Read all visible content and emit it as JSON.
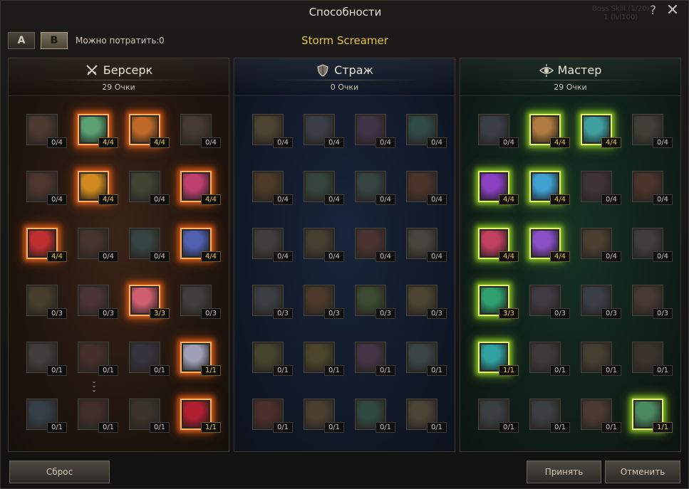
{
  "window": {
    "title": "Способности",
    "help_label": "?",
    "close_label": "✕",
    "ghost_lines": [
      "Boss Skill (1/20)",
      "1 (lvl100)"
    ]
  },
  "toolbar": {
    "preset_a": "A",
    "preset_b": "B",
    "spend_label": "Можно потратить:",
    "spend_value": "0",
    "character": "Storm Screamer"
  },
  "colors": {
    "accent": "#f0c040",
    "active_red_glow": "#c85418",
    "active_green_glow": "#7ab420"
  },
  "trees": [
    {
      "name": "Берсерк",
      "icon": "crossed-swords-icon",
      "points": "29 Очки",
      "glow": "red",
      "skills": [
        {
          "rank": "0/4",
          "active": false,
          "c": "#8a5a48"
        },
        {
          "rank": "4/4",
          "active": true,
          "c": "#5aa070"
        },
        {
          "rank": "4/4",
          "active": true,
          "c": "#c06a28"
        },
        {
          "rank": "0/4",
          "active": false,
          "c": "#7a5a4a"
        },
        {
          "rank": "0/4",
          "active": false,
          "c": "#8a5040"
        },
        {
          "rank": "4/4",
          "active": true,
          "c": "#d08a20"
        },
        {
          "rank": "0/4",
          "active": false,
          "c": "#6a7a50"
        },
        {
          "rank": "4/4",
          "active": true,
          "c": "#c04070"
        },
        {
          "rank": "4/4",
          "active": true,
          "c": "#c03030"
        },
        {
          "rank": "0/4",
          "active": false,
          "c": "#7a4a3a"
        },
        {
          "rank": "0/4",
          "active": false,
          "c": "#4a7a7a"
        },
        {
          "rank": "4/4",
          "active": true,
          "c": "#5060b0"
        },
        {
          "rank": "0/3",
          "active": false,
          "c": "#7a6a3a"
        },
        {
          "rank": "0/3",
          "active": false,
          "c": "#8a4a5a"
        },
        {
          "rank": "3/3",
          "active": true,
          "c": "#d06070"
        },
        {
          "rank": "0/3",
          "active": false,
          "c": "#6a6a6a"
        },
        {
          "rank": "0/1",
          "active": false,
          "c": "#6a6a6a"
        },
        {
          "rank": "0/1",
          "active": false,
          "c": "#7a3a3a"
        },
        {
          "rank": "0/1",
          "active": false,
          "c": "#4a4a6a"
        },
        {
          "rank": "1/1",
          "active": true,
          "c": "#a0a0b8"
        },
        {
          "rank": "0/1",
          "active": false,
          "c": "#4a6a8a"
        },
        {
          "rank": "0/1",
          "active": false,
          "c": "#6a3a3a"
        },
        {
          "rank": "0/1",
          "active": false,
          "c": "#5a4a3a"
        },
        {
          "rank": "1/1",
          "active": true,
          "c": "#b02030"
        }
      ]
    },
    {
      "name": "Страж",
      "icon": "shield-icon",
      "points": "0 Очки",
      "glow": "none",
      "skills": [
        {
          "rank": "0/4",
          "active": false,
          "c": "#8a7a4a"
        },
        {
          "rank": "0/4",
          "active": false,
          "c": "#5a6a8a"
        },
        {
          "rank": "0/4",
          "active": false,
          "c": "#6a4a8a"
        },
        {
          "rank": "0/4",
          "active": false,
          "c": "#3a8a8a"
        },
        {
          "rank": "0/4",
          "active": false,
          "c": "#8a5a2a"
        },
        {
          "rank": "0/4",
          "active": false,
          "c": "#4a7a6a"
        },
        {
          "rank": "0/4",
          "active": false,
          "c": "#4a7a7a"
        },
        {
          "rank": "0/4",
          "active": false,
          "c": "#8a4a3a"
        },
        {
          "rank": "0/4",
          "active": false,
          "c": "#6a6a6a"
        },
        {
          "rank": "0/4",
          "active": false,
          "c": "#7a6a4a"
        },
        {
          "rank": "0/4",
          "active": false,
          "c": "#8a4a4a"
        },
        {
          "rank": "0/4",
          "active": false,
          "c": "#7a7a6a"
        },
        {
          "rank": "0/3",
          "active": false,
          "c": "#5a6a7a"
        },
        {
          "rank": "0/3",
          "active": false,
          "c": "#8a5a3a"
        },
        {
          "rank": "0/3",
          "active": false,
          "c": "#5a8a4a"
        },
        {
          "rank": "0/3",
          "active": false,
          "c": "#8a7a4a"
        },
        {
          "rank": "0/1",
          "active": false,
          "c": "#7a7a3a"
        },
        {
          "rank": "0/1",
          "active": false,
          "c": "#8a7a3a"
        },
        {
          "rank": "0/1",
          "active": false,
          "c": "#7a4a8a"
        },
        {
          "rank": "0/1",
          "active": false,
          "c": "#5a7a8a"
        },
        {
          "rank": "0/1",
          "active": false,
          "c": "#8a3a3a"
        },
        {
          "rank": "0/1",
          "active": false,
          "c": "#8a6a4a"
        },
        {
          "rank": "0/1",
          "active": false,
          "c": "#3a8a7a"
        },
        {
          "rank": "0/1",
          "active": false,
          "c": "#8a7a5a"
        }
      ]
    },
    {
      "name": "Мастер",
      "icon": "eye-icon",
      "points": "29 Очки",
      "glow": "green",
      "skills": [
        {
          "rank": "0/4",
          "active": false,
          "c": "#5a6a8a"
        },
        {
          "rank": "4/4",
          "active": true,
          "c": "#b07a40"
        },
        {
          "rank": "4/4",
          "active": true,
          "c": "#40a0a0"
        },
        {
          "rank": "0/4",
          "active": false,
          "c": "#6a6a5a"
        },
        {
          "rank": "4/4",
          "active": true,
          "c": "#8a40c0"
        },
        {
          "rank": "4/4",
          "active": true,
          "c": "#40a0d0"
        },
        {
          "rank": "0/4",
          "active": false,
          "c": "#6a4a5a"
        },
        {
          "rank": "0/4",
          "active": false,
          "c": "#8a4a3a"
        },
        {
          "rank": "4/4",
          "active": true,
          "c": "#c04060"
        },
        {
          "rank": "4/4",
          "active": true,
          "c": "#8a50c8"
        },
        {
          "rank": "0/4",
          "active": false,
          "c": "#8a6a4a"
        },
        {
          "rank": "0/4",
          "active": false,
          "c": "#6a6a6a"
        },
        {
          "rank": "3/3",
          "active": true,
          "c": "#30a070"
        },
        {
          "rank": "0/3",
          "active": false,
          "c": "#6a5a7a"
        },
        {
          "rank": "0/3",
          "active": false,
          "c": "#5a6a8a"
        },
        {
          "rank": "0/3",
          "active": false,
          "c": "#7a5a4a"
        },
        {
          "rank": "1/1",
          "active": true,
          "c": "#30a0a0"
        },
        {
          "rank": "0/1",
          "active": false,
          "c": "#6a5a6a"
        },
        {
          "rank": "0/1",
          "active": false,
          "c": "#7a6a4a"
        },
        {
          "rank": "0/1",
          "active": false,
          "c": "#5a4a3a"
        },
        {
          "rank": "0/1",
          "active": false,
          "c": "#5a6a7a"
        },
        {
          "rank": "0/1",
          "active": false,
          "c": "#5a6a7a"
        },
        {
          "rank": "0/1",
          "active": false,
          "c": "#8a5a4a"
        },
        {
          "rank": "1/1",
          "active": true,
          "c": "#4a8a60"
        }
      ]
    }
  ],
  "footer": {
    "reset": "Сброс",
    "accept": "Принять",
    "cancel": "Отменить"
  }
}
